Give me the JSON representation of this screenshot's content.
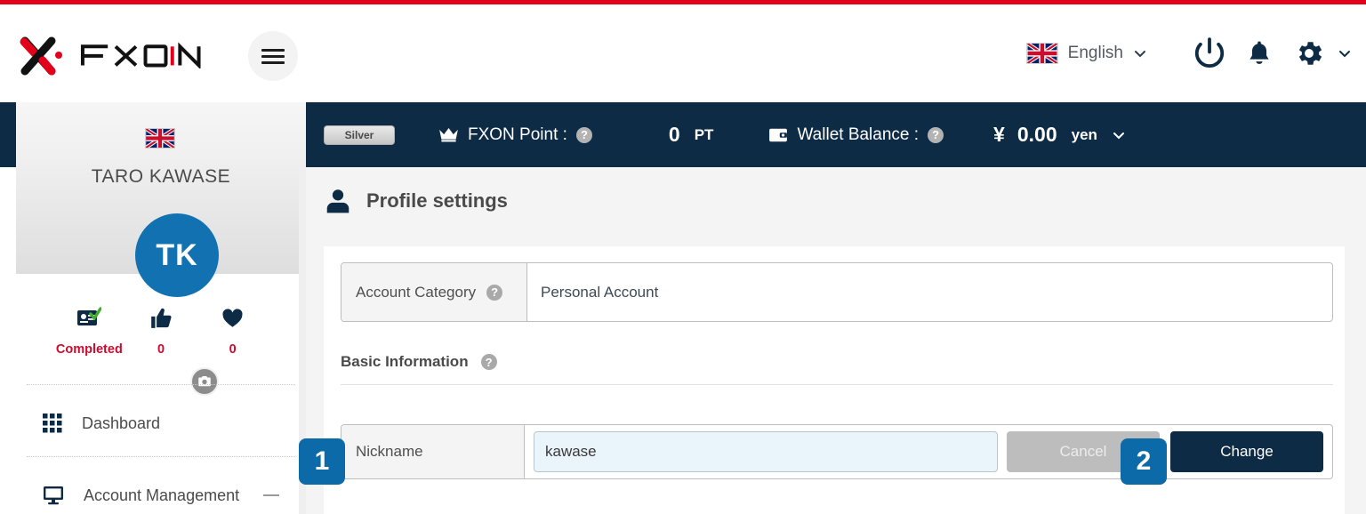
{
  "brand": {
    "logo_text": "FXON",
    "accent_red": "#e3001b",
    "navy": "#0d2b45",
    "blue": "#0d6aa8"
  },
  "header": {
    "menu_icon": "hamburger-menu-icon",
    "language": {
      "flag": "uk-flag-icon",
      "label": "English",
      "chevron": "chevron-down-icon"
    },
    "power_icon": "power-icon",
    "notification_icon": "bell-icon",
    "settings_icon": "gear-icon",
    "settings_chevron": "chevron-down-icon"
  },
  "sidebar": {
    "flag": "uk-flag-icon",
    "user_name": "TARO KAWASE",
    "avatar_initials": "TK",
    "camera_icon": "camera-icon",
    "stats": [
      {
        "icon": "id-card-verified-icon",
        "label": "Completed"
      },
      {
        "icon": "thumbs-up-icon",
        "label": "0"
      },
      {
        "icon": "heart-icon",
        "label": "0"
      }
    ],
    "nav": [
      {
        "icon": "grid-icon",
        "label": "Dashboard",
        "expander": ""
      },
      {
        "icon": "monitor-icon",
        "label": "Account Management",
        "expander": "minus-icon"
      }
    ]
  },
  "statusbar": {
    "rank": "Silver",
    "point": {
      "icon": "crown-icon",
      "label": "FXON Point :",
      "help": "help-icon",
      "value": "0",
      "unit": "PT"
    },
    "wallet": {
      "icon": "wallet-icon",
      "label": "Wallet Balance :",
      "help": "help-icon",
      "currency_symbol": "¥",
      "value": "0.00",
      "unit": "yen",
      "chevron": "chevron-down-icon"
    }
  },
  "main": {
    "page_icon": "person-icon",
    "page_title": "Profile settings",
    "account_category": {
      "key_label": "Account Category",
      "help": "help-icon",
      "value": "Personal Account"
    },
    "basic_information": {
      "section_title": "Basic Information",
      "help": "help-icon"
    },
    "nickname_row": {
      "key_label": "Nickname",
      "input_value": "kawase",
      "input_placeholder": "Nickname",
      "cancel_label": "Cancel",
      "change_label": "Change"
    }
  },
  "steps": {
    "step_one": "1",
    "step_two": "2"
  }
}
